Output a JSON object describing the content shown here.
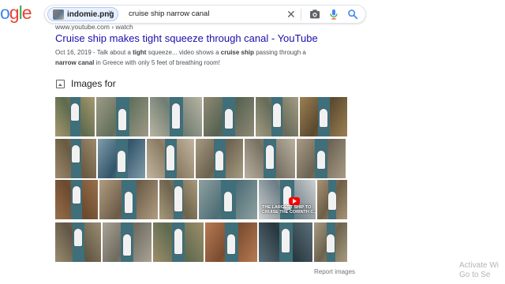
{
  "header": {
    "logo_letters": [
      "o",
      "g",
      "l",
      "e"
    ],
    "chip_label": "indomie.png",
    "chip_close": "×",
    "query": "cruise ship narrow canal",
    "clear_glyph": "✕"
  },
  "result": {
    "breadcrumb": "www.youtube.com › watch",
    "title": "Cruise ship makes tight squeeze through canal - YouTube",
    "snippet_date": "Oct 16, 2019",
    "snippet_parts": [
      " - Talk about a ",
      "tight",
      " squeeze... video shows a ",
      "cruise ship",
      " passing through a ",
      "narrow canal",
      " in Greece with only 5 feet of breathing room!"
    ]
  },
  "images": {
    "heading": "Images for",
    "overlay_lines": [
      "THE LARGEST SHIP TO",
      "CRUISE THE CORINTH C..."
    ],
    "tile_alt": "cruise ship in narrow canal",
    "rows": [
      [
        {
          "w": 50,
          "c1": "#a7986e",
          "c2": "#5d6b4e"
        },
        {
          "w": 66,
          "c1": "#9d9a86",
          "c2": "#62705b"
        },
        {
          "w": 66,
          "c1": "#b8b4a2",
          "c2": "#6f7d72"
        },
        {
          "w": 64,
          "c1": "#8f8a74",
          "c2": "#566252"
        },
        {
          "w": 54,
          "c1": "#a39c82",
          "c2": "#666b59"
        },
        {
          "w": 60,
          "c1": "#9b7f52",
          "c2": "#5b4a2f"
        }
      ],
      [
        {
          "w": 52,
          "c1": "#9c8a6c",
          "c2": "#6a5a42"
        },
        {
          "w": 60,
          "c1": "#7f9ca8",
          "c2": "#33556b"
        },
        {
          "w": 60,
          "c1": "#c2b6a0",
          "c2": "#8a7a62"
        },
        {
          "w": 60,
          "c1": "#a69a80",
          "c2": "#6b6250"
        },
        {
          "w": 64,
          "c1": "#b9b1a0",
          "c2": "#776f60"
        },
        {
          "w": 62,
          "c1": "#a89b85",
          "c2": "#6b6353"
        }
      ],
      [
        {
          "w": 54,
          "c1": "#9a6f4a",
          "c2": "#6b4a2f"
        },
        {
          "w": 74,
          "c1": "#b09c80",
          "c2": "#6a5a46"
        },
        {
          "w": 48,
          "c1": "#a79a7c",
          "c2": "#6e634c"
        },
        {
          "w": 74,
          "c1": "#8ea0a0",
          "c2": "#4e6d75"
        },
        {
          "w": 72,
          "c1": "#cfcfcf",
          "c2": "#6a7d86"
        },
        {
          "w": 38,
          "c1": "#a89475",
          "c2": "#6e5f48"
        }
      ],
      [
        {
          "w": 58,
          "c1": "#9a8c70",
          "c2": "#5f5644"
        },
        {
          "w": 62,
          "c1": "#aaa396",
          "c2": "#6f6b60"
        },
        {
          "w": 64,
          "c1": "#9d8e6a",
          "c2": "#5e6a4f"
        },
        {
          "w": 66,
          "c1": "#b67a52",
          "c2": "#7a4c30"
        },
        {
          "w": 68,
          "c1": "#5c6f78",
          "c2": "#283840"
        },
        {
          "w": 42,
          "c1": "#a89a80",
          "c2": "#6c634f"
        }
      ]
    ]
  },
  "footer": {
    "report": "Report images",
    "watermark_line1": "Activate Wi",
    "watermark_line2": "Go to Se"
  }
}
